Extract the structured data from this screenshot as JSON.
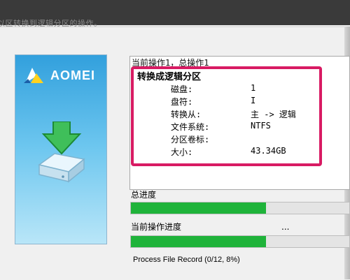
{
  "caption": "以区转换到逻辑分区的操作。",
  "brand": {
    "name": "AOMEI",
    "logo_icon": "aomei-triangle-logo-icon",
    "hero_icon": "disk-with-down-arrow-icon"
  },
  "operation": {
    "count_label": "当前操作1，总操作1",
    "title": "转换成逻辑分区",
    "details": [
      {
        "key": "磁盘:",
        "value": "1"
      },
      {
        "key": "盘符:",
        "value": "I"
      },
      {
        "key": "转换从:",
        "value": "主 -> 逻辑"
      },
      {
        "key": "文件系统:",
        "value": "NTFS"
      },
      {
        "key": "分区卷标:",
        "value": ""
      },
      {
        "key": "大小:",
        "value": "43.34GB"
      }
    ]
  },
  "progress": {
    "total_label": "总进度",
    "total_fraction": 0.62,
    "current_label": "当前操作进度",
    "current_dots": "...",
    "current_fraction": 0.62,
    "status": "Process File Record (0/12, 8%)"
  },
  "colors": {
    "highlight_frame": "#d81b63",
    "progress_fill": "#1fb33a",
    "panel_top": "#32a0dd"
  }
}
